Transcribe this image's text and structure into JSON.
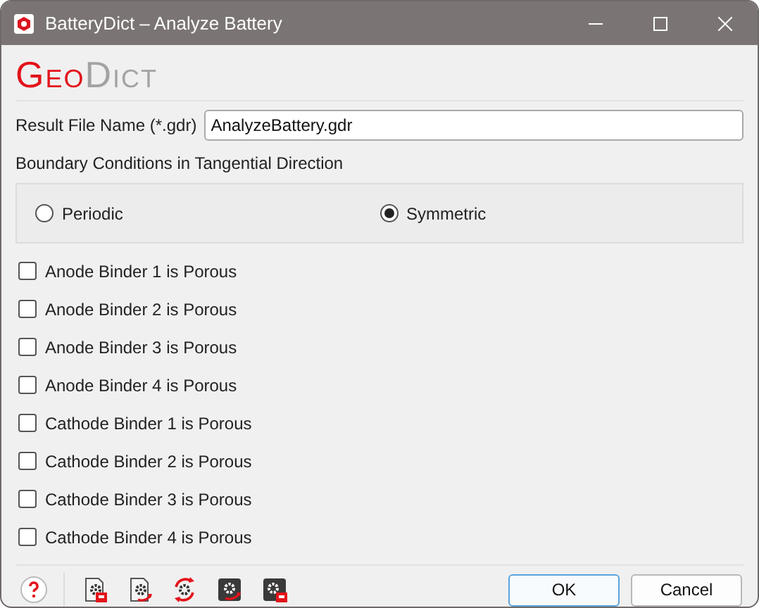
{
  "window": {
    "title": "BatteryDict – Analyze Battery"
  },
  "logo": [
    {
      "text": "Geo",
      "kind": "accent"
    },
    {
      "text": "Dict",
      "kind": "plain"
    }
  ],
  "result_file": {
    "label": "Result File Name (*.gdr)",
    "value": "AnalyzeBattery.gdr"
  },
  "boundary": {
    "label": "Boundary Conditions in Tangential Direction",
    "options": [
      {
        "label": "Periodic",
        "selected": false
      },
      {
        "label": "Symmetric",
        "selected": true
      }
    ]
  },
  "checkboxes": [
    {
      "label": "Anode Binder 1 is Porous",
      "checked": false
    },
    {
      "label": "Anode Binder 2 is Porous",
      "checked": false
    },
    {
      "label": "Anode Binder 3 is Porous",
      "checked": false
    },
    {
      "label": "Anode Binder 4 is Porous",
      "checked": false
    },
    {
      "label": "Cathode Binder 1 is Porous",
      "checked": false
    },
    {
      "label": "Cathode Binder 2 is Porous",
      "checked": false
    },
    {
      "label": "Cathode Binder 3 is Porous",
      "checked": false
    },
    {
      "label": "Cathode Binder 4 is Porous",
      "checked": false
    }
  ],
  "toolbar": [
    {
      "kind": "help"
    },
    {
      "kind": "save-file"
    },
    {
      "kind": "load-file"
    },
    {
      "kind": "reset"
    },
    {
      "kind": "load-dark"
    },
    {
      "kind": "save-dark"
    }
  ],
  "buttons": [
    {
      "label": "OK",
      "kind": "default"
    },
    {
      "label": "Cancel",
      "kind": "normal"
    }
  ]
}
